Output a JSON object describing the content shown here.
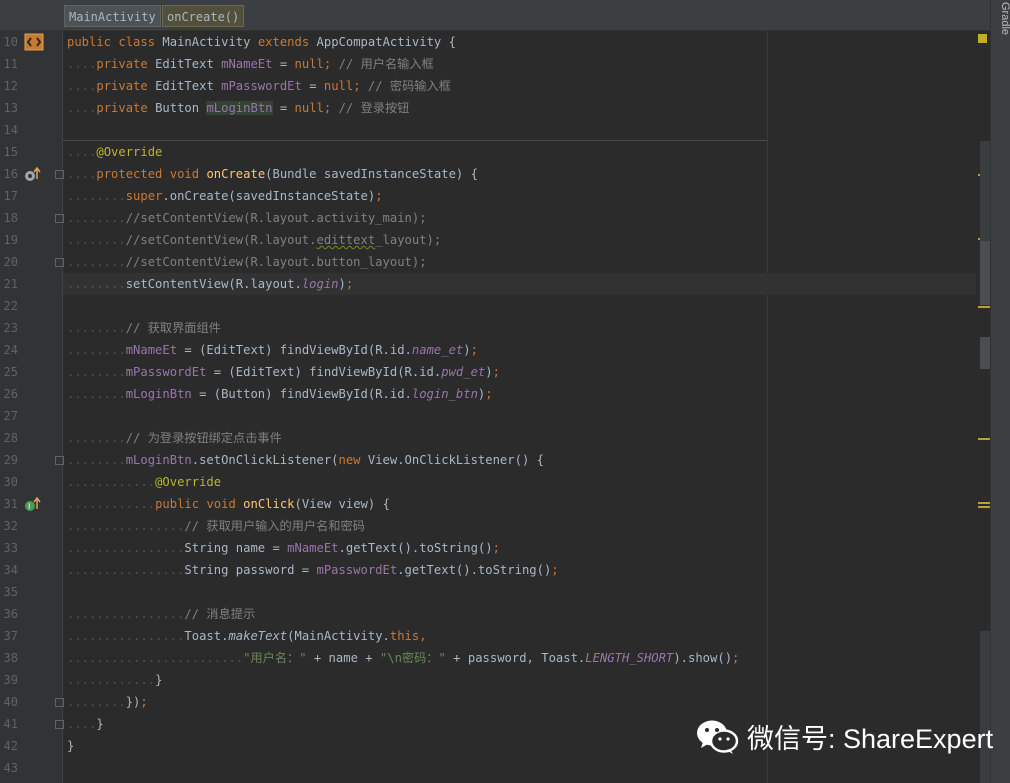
{
  "breadcrumb": {
    "class_name": "MainActivity",
    "method_name": "onCreate()"
  },
  "sidebar": {
    "gradle_label": "Gradle"
  },
  "watermark": {
    "text": "微信号: ShareExpert"
  },
  "colors": {
    "keyword": "#cc7832",
    "field": "#9876aa",
    "comment": "#808080",
    "string": "#6a8759",
    "annotation": "#bbb529",
    "method_decl": "#ffc66d",
    "plain": "#a9b7c6",
    "background": "#2b2b2b",
    "gutter": "#313335"
  },
  "gutter": {
    "line_numbers": [
      "10",
      "11",
      "12",
      "13",
      "14",
      "15",
      "16",
      "17",
      "18",
      "19",
      "20",
      "21",
      "22",
      "23",
      "24",
      "25",
      "26",
      "27",
      "28",
      "29",
      "30",
      "31",
      "32",
      "33",
      "34",
      "35",
      "36",
      "37",
      "38",
      "39",
      "40",
      "41",
      "42",
      "43"
    ],
    "icons": [
      "class-icon",
      "override-method-icon",
      "implement-method-icon"
    ]
  },
  "code": {
    "l10": {
      "kw_public": "public",
      "kw_class": "class",
      "cls": "MainActivity",
      "kw_extends": "extends",
      "sup": "AppCompatActivity",
      "brace": "{"
    },
    "l11": {
      "kw_private": "private",
      "type": "EditText",
      "field": "mNameEt",
      "eq": "=",
      "null": "null",
      "semi": ";",
      "comment": "// 用户名输入框"
    },
    "l12": {
      "kw_private": "private",
      "type": "EditText",
      "field": "mPasswordEt",
      "eq": "=",
      "null": "null",
      "semi": ";",
      "comment": "// 密码输入框"
    },
    "l13": {
      "kw_private": "private",
      "type": "Button",
      "field": "mLoginBtn",
      "eq": "=",
      "null": "null",
      "semi": ";",
      "comment": "// 登录按钮"
    },
    "l15": {
      "annotation": "@Override"
    },
    "l16": {
      "kw_protected": "protected",
      "kw_void": "void",
      "name": "onCreate",
      "sig": "(Bundle savedInstanceState)",
      "brace": "{"
    },
    "l17": {
      "kw_super": "super",
      "rest": ".onCreate(savedInstanceState)",
      "semi": ";"
    },
    "l18": {
      "comment": "//setContentView(R.layout.activity_main);"
    },
    "l19": {
      "c1": "//setContentView(R.layout.",
      "c2": "edittext",
      "c3": "_layout);"
    },
    "l20": {
      "comment": "//setContentView(R.layout.button_layout);"
    },
    "l21": {
      "pre": "setContentView(R.layout.",
      "field": "login",
      "post": ")",
      "semi": ";"
    },
    "l23": {
      "comment": "// 获取界面组件"
    },
    "l24": {
      "field": "mNameEt",
      "mid": " = (EditText) findViewById(R.id.",
      "rid": "name_et",
      "post": ")",
      "semi": ";"
    },
    "l25": {
      "field": "mPasswordEt",
      "mid": " = (EditText) findViewById(R.id.",
      "rid": "pwd_et",
      "post": ")",
      "semi": ";"
    },
    "l26": {
      "field": "mLoginBtn",
      "mid": " = (Button) findViewById(R.id.",
      "rid": "login_btn",
      "post": ")",
      "semi": ";"
    },
    "l28": {
      "comment": "// 为登录按钮绑定点击事件"
    },
    "l29": {
      "field": "mLoginBtn",
      "mid": ".setOnClickListener(",
      "kw_new": "new",
      "rest": " View.OnClickListener() {"
    },
    "l30": {
      "annotation": "@Override"
    },
    "l31": {
      "kw_public": "public",
      "kw_void": "void",
      "name": "onClick",
      "sig": "(View view)",
      "brace": "{"
    },
    "l32": {
      "comment": "// 获取用户输入的用户名和密码"
    },
    "l33": {
      "pre": "String name = ",
      "field": "mNameEt",
      "post": ".getText().toString()",
      "semi": ";"
    },
    "l34": {
      "pre": "String password = ",
      "field": "mPasswordEt",
      "post": ".getText().toString()",
      "semi": ";"
    },
    "l36": {
      "comment": "// 消息提示"
    },
    "l37": {
      "pre": "Toast.",
      "method": "makeText",
      "mid": "(MainActivity.",
      "kw_this": "this",
      "comma": ","
    },
    "l38": {
      "str1": "\"用户名：\"",
      "mid": " + name + ",
      "str2": "\"\\n密码：\"",
      "mid2": " + password, Toast.",
      "const": "LENGTH_SHORT",
      "post": ").show()",
      "semi": ";"
    },
    "l39": {
      "text": "}"
    },
    "l40": {
      "text": "})",
      "semi": ";"
    },
    "l41": {
      "text": "}"
    },
    "l42": {
      "text": "}"
    }
  }
}
